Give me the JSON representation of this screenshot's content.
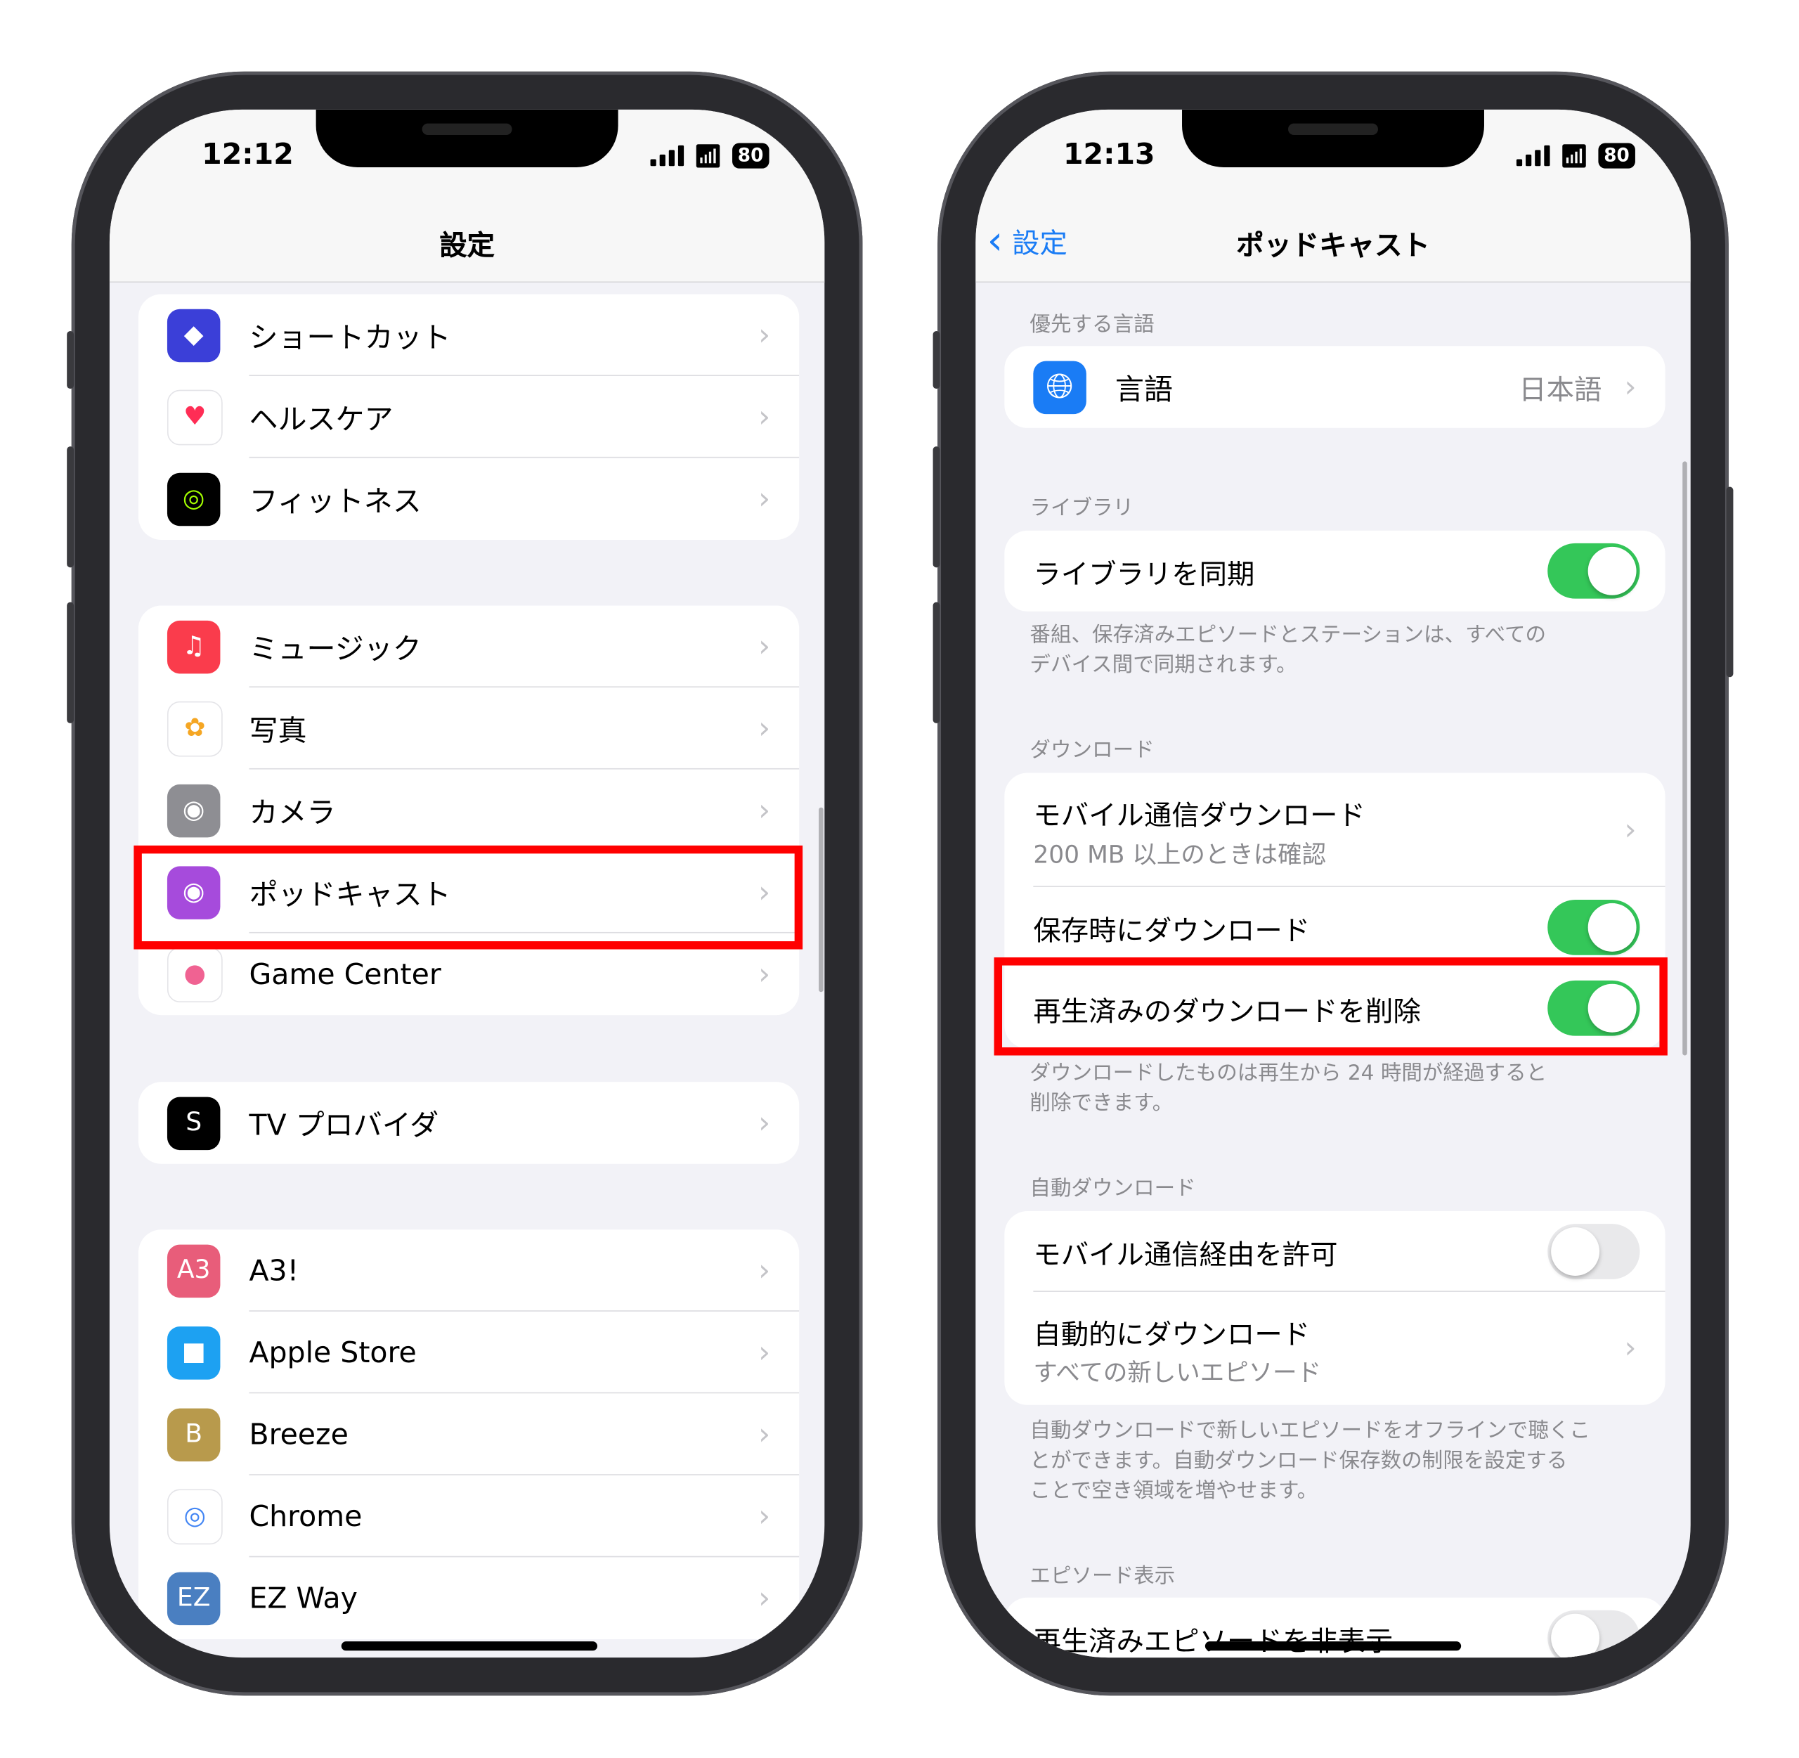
{
  "left_phone": {
    "status": {
      "time": "12:12",
      "battery": "80"
    },
    "nav_title": "設定",
    "groups": [
      [
        {
          "label": "ショートカット",
          "icon": "shortcuts-icon",
          "color": "#3b3fd8"
        },
        {
          "label": "ヘルスケア",
          "icon": "health-heart-icon",
          "color": "#ffffff"
        },
        {
          "label": "フィットネス",
          "icon": "fitness-rings-icon",
          "color": "#000000"
        }
      ],
      [
        {
          "label": "ミュージック",
          "icon": "music-note-icon",
          "color": "#fa3c4c"
        },
        {
          "label": "写真",
          "icon": "photos-flower-icon",
          "color": "#ffffff"
        },
        {
          "label": "カメラ",
          "icon": "camera-icon",
          "color": "#8e8e93"
        },
        {
          "label": "ポッドキャスト",
          "icon": "podcasts-icon",
          "color": "#a64bdc",
          "highlighted": true
        },
        {
          "label": "Game Center",
          "icon": "game-center-icon",
          "color": "#ffffff"
        }
      ],
      [
        {
          "label": "TV プロバイダ",
          "icon": "tv-provider-icon",
          "color": "#000000"
        }
      ],
      [
        {
          "label": "A3!",
          "icon": "a3-app-icon",
          "color": "#e85d7a"
        },
        {
          "label": "Apple Store",
          "icon": "apple-store-bag-icon",
          "color": "#1da1f2"
        },
        {
          "label": "Breeze",
          "icon": "breeze-app-icon",
          "color": "#b89a4c"
        },
        {
          "label": "Chrome",
          "icon": "chrome-icon",
          "color": "#ffffff"
        },
        {
          "label": "EZ Way",
          "icon": "ez-way-app-icon",
          "color": "#4a7fc1"
        }
      ]
    ]
  },
  "right_phone": {
    "status": {
      "time": "12:13",
      "battery": "80"
    },
    "back_label": "設定",
    "nav_title": "ポッドキャスト",
    "sections": {
      "language": {
        "header": "優先する言語",
        "row_label": "言語",
        "row_value": "日本語"
      },
      "library": {
        "header": "ライブラリ",
        "row_label": "ライブラリを同期",
        "toggle_on": true,
        "footer": [
          "番組、保存済みエピソードとステーションは、すべての",
          "デバイス間で同期されます。"
        ]
      },
      "download": {
        "header": "ダウンロード",
        "cellular_label": "モバイル通信ダウンロード",
        "cellular_sub": "200 MB 以上のときは確認",
        "save_label": "保存時にダウンロード",
        "save_on": true,
        "delete_label": "再生済みのダウンロードを削除",
        "delete_on": true,
        "footer": [
          "ダウンロードしたものは再生から 24 時間が経過すると",
          "削除できます。"
        ]
      },
      "auto_download": {
        "header": "自動ダウンロード",
        "allow_cellular_label": "モバイル通信経由を許可",
        "allow_cellular_on": false,
        "auto_label": "自動的にダウンロード",
        "auto_sub": "すべての新しいエピソード",
        "footer": [
          "自動ダウンロードで新しいエピソードをオフラインで聴くこ",
          "とができます。自動ダウンロード保存数の制限を設定する",
          "ことで空き領域を増やせます。"
        ]
      },
      "episode_display": {
        "header": "エピソード表示",
        "hide_played_label": "再生済みエピソードを非表示",
        "hide_played_on": false
      }
    }
  },
  "colors": {
    "accent_blue": "#1a7cf5",
    "toggle_green": "#34c759",
    "highlight_red": "#ff0000"
  }
}
